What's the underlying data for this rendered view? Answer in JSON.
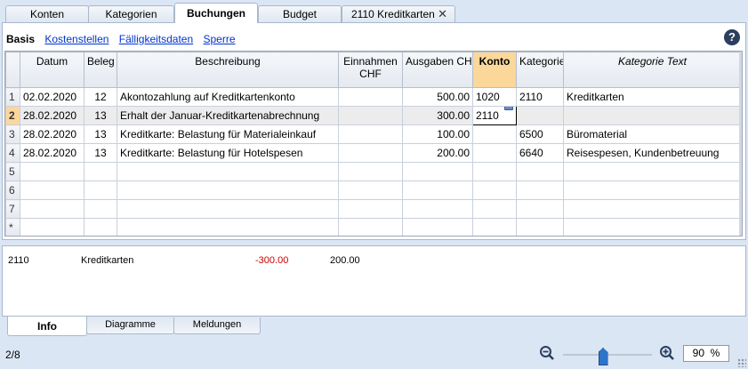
{
  "top_tabs": [
    {
      "label": "Konten"
    },
    {
      "label": "Kategorien"
    },
    {
      "label": "Buchungen"
    },
    {
      "label": "Budget"
    },
    {
      "label": "2110 Kreditkarten"
    }
  ],
  "views": {
    "active": "Basis",
    "links": [
      "Kostenstellen",
      "Fälligkeitsdaten",
      "Sperre"
    ]
  },
  "help": "?",
  "columns": {
    "datum": "Datum",
    "beleg": "Beleg",
    "beschreibung": "Beschreibung",
    "einnahmen": "Einnahmen CHF",
    "ausgaben": "Ausgaben CHF",
    "konto": "Konto",
    "kategorie": "Kategorie",
    "kategorie_text": "Kategorie Text"
  },
  "rows": [
    {
      "num": "1",
      "datum": "02.02.2020",
      "beleg": "12",
      "beschreibung": "Akontozahlung auf Kreditkartenkonto",
      "einnahmen": "",
      "ausgaben": "500.00",
      "konto": "1020",
      "kategorie": "2110",
      "kategorie_text": "Kreditkarten"
    },
    {
      "num": "2",
      "datum": "28.02.2020",
      "beleg": "13",
      "beschreibung": "Erhalt der Januar-Kreditkartenabrechnung",
      "einnahmen": "",
      "ausgaben": "300.00",
      "konto": "2110",
      "kategorie": "",
      "kategorie_text": ""
    },
    {
      "num": "3",
      "datum": "28.02.2020",
      "beleg": "13",
      "beschreibung": "Kreditkarte:  Belastung für Materialeinkauf",
      "einnahmen": "",
      "ausgaben": "100.00",
      "konto": "",
      "kategorie": "6500",
      "kategorie_text": "Büromaterial"
    },
    {
      "num": "4",
      "datum": "28.02.2020",
      "beleg": "13",
      "beschreibung": "Kreditkarte:  Belastung für Hotelspesen",
      "einnahmen": "",
      "ausgaben": "200.00",
      "konto": "",
      "kategorie": "6640",
      "kategorie_text": "Reisespesen, Kundenbetreuung"
    },
    {
      "num": "5"
    },
    {
      "num": "6"
    },
    {
      "num": "7"
    },
    {
      "num": "*"
    }
  ],
  "info": {
    "account": "2110",
    "name": "Kreditkarten",
    "amount_neg": "-300.00",
    "amount": "200.00"
  },
  "bottom_tabs": [
    {
      "label": "Info"
    },
    {
      "label": "Diagramme"
    },
    {
      "label": "Meldungen"
    }
  ],
  "status": {
    "page": "2/8",
    "zoom_value": "90",
    "zoom_unit": "%",
    "zoom_level": 0.45
  },
  "colors": {
    "konto_highlight": "#fcd79a",
    "link": "#0033cc",
    "negative": "#cc0000"
  }
}
